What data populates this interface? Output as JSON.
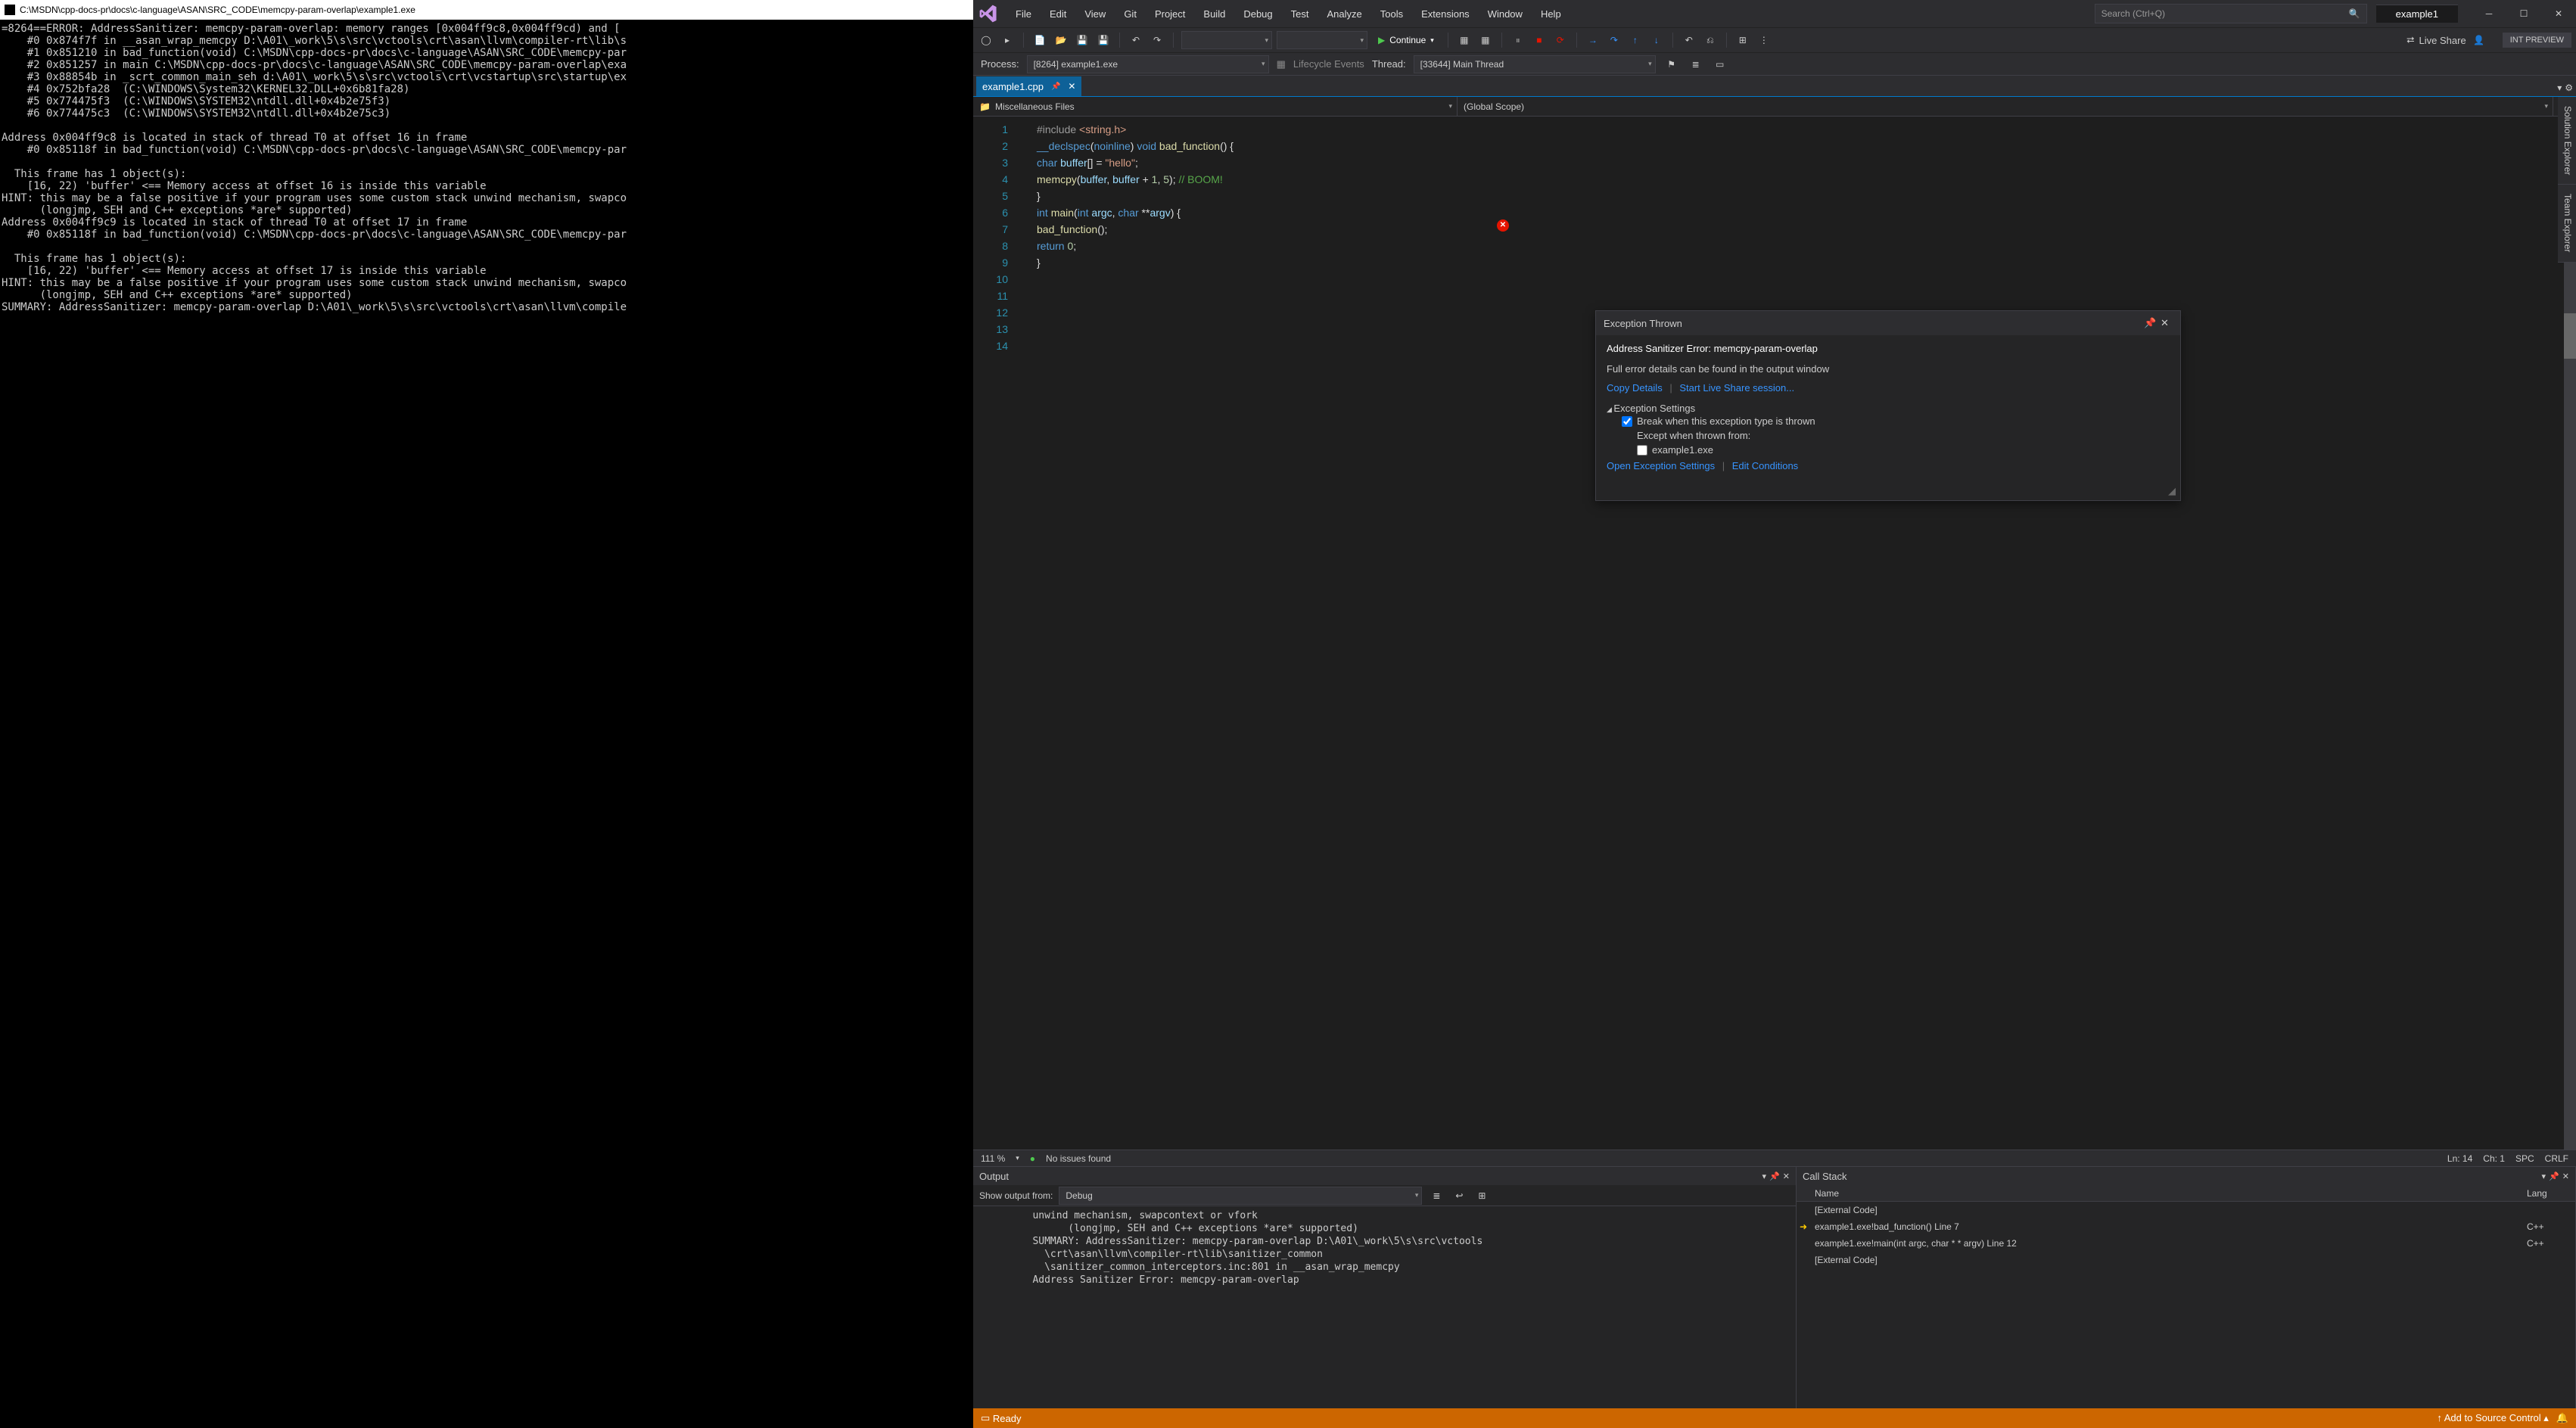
{
  "console": {
    "title": "C:\\MSDN\\cpp-docs-pr\\docs\\c-language\\ASAN\\SRC_CODE\\memcpy-param-overlap\\example1.exe",
    "text": "=8264==ERROR: AddressSanitizer: memcpy-param-overlap: memory ranges [0x004ff9c8,0x004ff9cd) and [\n    #0 0x874f7f in __asan_wrap_memcpy D:\\A01\\_work\\5\\s\\src\\vctools\\crt\\asan\\llvm\\compiler-rt\\lib\\s\n    #1 0x851210 in bad_function(void) C:\\MSDN\\cpp-docs-pr\\docs\\c-language\\ASAN\\SRC_CODE\\memcpy-par\n    #2 0x851257 in main C:\\MSDN\\cpp-docs-pr\\docs\\c-language\\ASAN\\SRC_CODE\\memcpy-param-overlap\\exa\n    #3 0x88854b in _scrt_common_main_seh d:\\A01\\_work\\5\\s\\src\\vctools\\crt\\vcstartup\\src\\startup\\ex\n    #4 0x752bfa28  (C:\\WINDOWS\\System32\\KERNEL32.DLL+0x6b81fa28)\n    #5 0x774475f3  (C:\\WINDOWS\\SYSTEM32\\ntdll.dll+0x4b2e75f3)\n    #6 0x774475c3  (C:\\WINDOWS\\SYSTEM32\\ntdll.dll+0x4b2e75c3)\n\nAddress 0x004ff9c8 is located in stack of thread T0 at offset 16 in frame\n    #0 0x85118f in bad_function(void) C:\\MSDN\\cpp-docs-pr\\docs\\c-language\\ASAN\\SRC_CODE\\memcpy-par\n\n  This frame has 1 object(s):\n    [16, 22) 'buffer' <== Memory access at offset 16 is inside this variable\nHINT: this may be a false positive if your program uses some custom stack unwind mechanism, swapco\n      (longjmp, SEH and C++ exceptions *are* supported)\nAddress 0x004ff9c9 is located in stack of thread T0 at offset 17 in frame\n    #0 0x85118f in bad_function(void) C:\\MSDN\\cpp-docs-pr\\docs\\c-language\\ASAN\\SRC_CODE\\memcpy-par\n\n  This frame has 1 object(s):\n    [16, 22) 'buffer' <== Memory access at offset 17 is inside this variable\nHINT: this may be a false positive if your program uses some custom stack unwind mechanism, swapco\n      (longjmp, SEH and C++ exceptions *are* supported)\nSUMMARY: AddressSanitizer: memcpy-param-overlap D:\\A01\\_work\\5\\s\\src\\vctools\\crt\\asan\\llvm\\compile"
  },
  "menu": {
    "items": [
      "File",
      "Edit",
      "View",
      "Git",
      "Project",
      "Build",
      "Debug",
      "Test",
      "Analyze",
      "Tools",
      "Extensions",
      "Window",
      "Help"
    ]
  },
  "search_placeholder": "Search (Ctrl+Q)",
  "solution_tab": "example1",
  "continue_label": "Continue",
  "live_share_label": "Live Share",
  "int_preview": "INT PREVIEW",
  "debug": {
    "process_label": "Process:",
    "process_value": "[8264] example1.exe",
    "lifecycle": "Lifecycle Events",
    "thread_label": "Thread:",
    "thread_value": "[33644] Main Thread"
  },
  "doc_tab": "example1.cpp",
  "nav": {
    "left": "Miscellaneous Files",
    "mid": "(Global Scope)",
    "right": ""
  },
  "code_lines": [
    "1",
    "2",
    "3",
    "4",
    "5",
    "6",
    "7",
    "8",
    "9",
    "10",
    "11",
    "12",
    "13",
    "14"
  ],
  "issues": {
    "zoom": "111 %",
    "status": "No issues found",
    "ln": "Ln: 14",
    "ch": "Ch: 1",
    "spc": "SPC",
    "crlf": "CRLF"
  },
  "exception": {
    "title": "Exception Thrown",
    "error": "Address Sanitizer Error: memcpy-param-overlap",
    "detail": "Full error details can be found in the output window",
    "copy": "Copy Details",
    "start_ls": "Start Live Share session...",
    "settings_hdr": "Exception Settings",
    "break_label": "Break when this exception type is thrown",
    "except_label": "Except when thrown from:",
    "except_item": "example1.exe",
    "open_settings": "Open Exception Settings",
    "edit_cond": "Edit Conditions"
  },
  "output": {
    "title": "Output",
    "show_label": "Show output from:",
    "show_value": "Debug",
    "body": "         unwind mechanism, swapcontext or vfork\n               (longjmp, SEH and C++ exceptions *are* supported)\n         SUMMARY: AddressSanitizer: memcpy-param-overlap D:\\A01\\_work\\5\\s\\src\\vctools\n           \\crt\\asan\\llvm\\compiler-rt\\lib\\sanitizer_common\n           \\sanitizer_common_interceptors.inc:801 in __asan_wrap_memcpy\n         Address Sanitizer Error: memcpy-param-overlap"
  },
  "callstack": {
    "title": "Call Stack",
    "col_name": "Name",
    "col_lang": "Lang",
    "rows": [
      {
        "name": "[External Code]",
        "lang": "",
        "ext": true,
        "arrow": false
      },
      {
        "name": "example1.exe!bad_function() Line 7",
        "lang": "C++",
        "ext": false,
        "arrow": true
      },
      {
        "name": "example1.exe!main(int argc, char * * argv) Line 12",
        "lang": "C++",
        "ext": false,
        "arrow": false
      },
      {
        "name": "[External Code]",
        "lang": "",
        "ext": true,
        "arrow": false
      }
    ]
  },
  "status": {
    "ready": "Ready",
    "add_src": "Add to Source Control"
  },
  "side_tabs": [
    "Solution Explorer",
    "Team Explorer"
  ]
}
